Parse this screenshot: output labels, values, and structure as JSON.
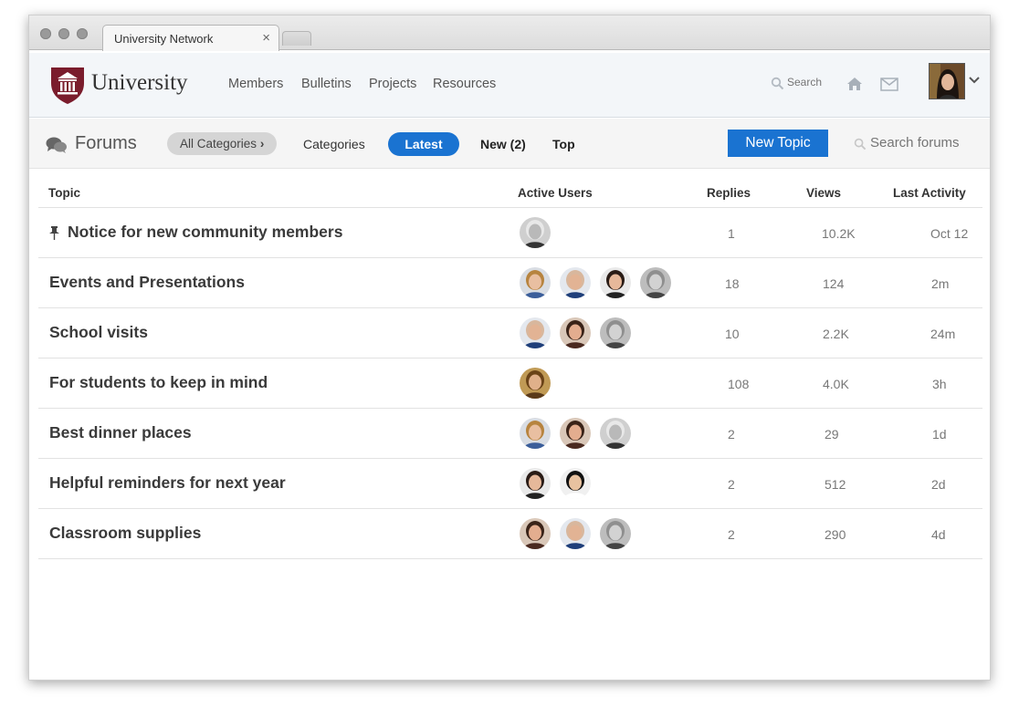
{
  "browser": {
    "tab_title": "University Network",
    "tab_close": "×"
  },
  "header": {
    "brand": "University",
    "nav": [
      "Members",
      "Bulletins",
      "Projects",
      "Resources"
    ],
    "search_placeholder": "Search",
    "accent_color": "#7a1c2c"
  },
  "forum_bar": {
    "title": "Forums",
    "all_categories": "All Categories",
    "chevron": "›",
    "categories": "Categories",
    "latest": "Latest",
    "new": "New (2)",
    "top": "Top",
    "new_topic": "New Topic",
    "search_placeholder": "Search forums",
    "primary_color": "#1a73d1"
  },
  "table": {
    "headers": {
      "topic": "Topic",
      "active_users": "Active Users",
      "replies": "Replies",
      "views": "Views",
      "last_activity": "Last Activity"
    },
    "rows": [
      {
        "title": "Notice for new community members",
        "pinned": true,
        "users": [
          "old-man-bw"
        ],
        "replies": "1",
        "views": "10.2K",
        "last": "Oct 12"
      },
      {
        "title": "Events and Presentations",
        "pinned": false,
        "users": [
          "woman-blond",
          "man-bald-glasses",
          "woman-dark-hair",
          "man-gray"
        ],
        "replies": "18",
        "views": "124",
        "last": "2m"
      },
      {
        "title": "School visits",
        "pinned": false,
        "users": [
          "man-bald-glasses",
          "woman-glasses",
          "man-gray"
        ],
        "replies": "10",
        "views": "2.2K",
        "last": "24m"
      },
      {
        "title": "For students to keep in mind",
        "pinned": false,
        "users": [
          "woman-curly"
        ],
        "replies": "108",
        "views": "4.0K",
        "last": "3h"
      },
      {
        "title": "Best dinner places",
        "pinned": false,
        "users": [
          "woman-blond",
          "woman-glasses",
          "old-man-bw"
        ],
        "replies": "2",
        "views": "29",
        "last": "1d"
      },
      {
        "title": "Helpful reminders for next year",
        "pinned": false,
        "users": [
          "woman-dark-hair",
          "man-asian-glasses"
        ],
        "replies": "2",
        "views": "512",
        "last": "2d"
      },
      {
        "title": "Classroom supplies",
        "pinned": false,
        "users": [
          "woman-glasses",
          "man-bald-glasses",
          "man-gray"
        ],
        "replies": "2",
        "views": "290",
        "last": "4d"
      }
    ]
  }
}
